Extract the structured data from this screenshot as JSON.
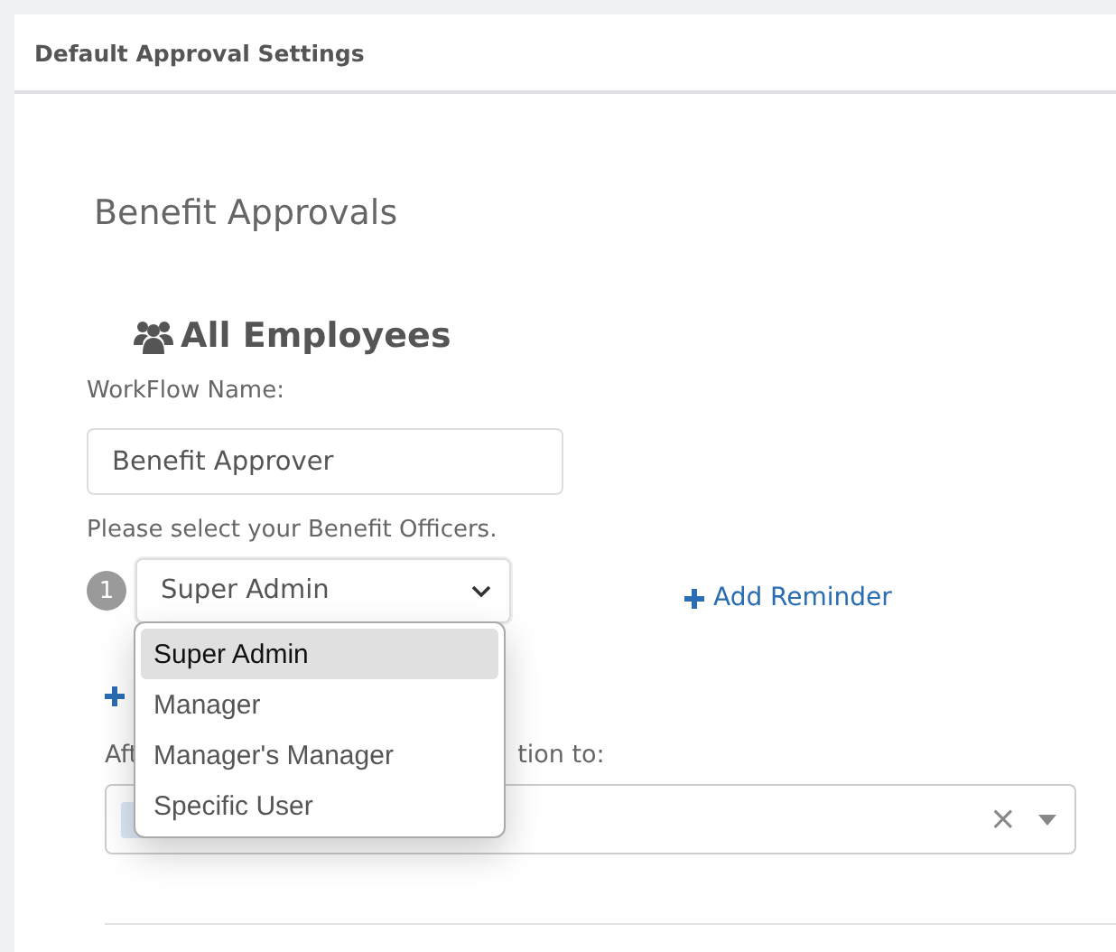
{
  "header": {
    "title": "Default Approval Settings"
  },
  "section": {
    "title": "Benefit Approvals",
    "group": "All Employees"
  },
  "workflow": {
    "label": "WorkFlow Name:",
    "value": "Benefit Approver"
  },
  "officers": {
    "label": "Please select your Benefit Officers.",
    "step": "1",
    "value": "Super Admin",
    "expanded": true,
    "reminder": "Add Reminder"
  },
  "options": [
    {
      "label": "Super Admin",
      "selected": true
    },
    {
      "label": "Manager",
      "selected": false
    },
    {
      "label": "Manager's Manager",
      "selected": false
    },
    {
      "label": "Specific User",
      "selected": false
    }
  ],
  "after": {
    "label_start": "Aft",
    "label_end": "tion to:",
    "clear": "×"
  }
}
